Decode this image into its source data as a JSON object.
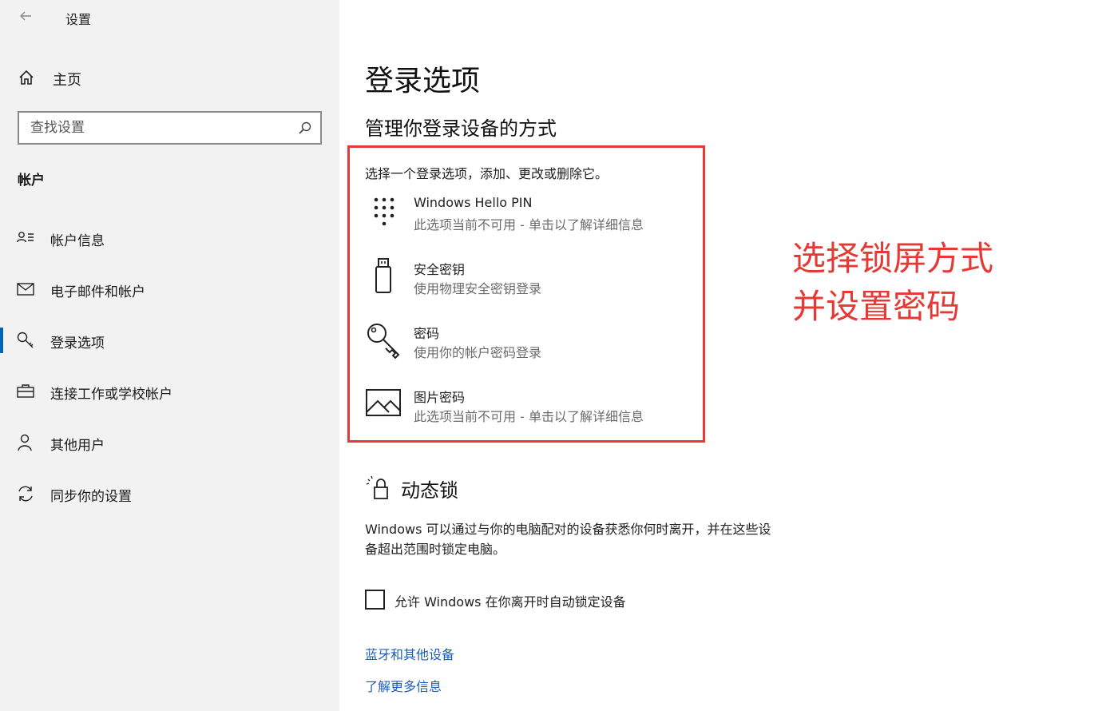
{
  "window": {
    "title": "设置"
  },
  "sidebar": {
    "home_label": "主页",
    "search_placeholder": "查找设置",
    "section_label": "帐户",
    "items": [
      {
        "label": "帐户信息",
        "icon": "account-info-icon"
      },
      {
        "label": "电子邮件和帐户",
        "icon": "mail-icon"
      },
      {
        "label": "登录选项",
        "icon": "key-icon",
        "active": true
      },
      {
        "label": "连接工作或学校帐户",
        "icon": "briefcase-icon"
      },
      {
        "label": "其他用户",
        "icon": "person-icon"
      },
      {
        "label": "同步你的设置",
        "icon": "sync-icon"
      }
    ],
    "accent_color": "#0063b1"
  },
  "main": {
    "title": "登录选项",
    "subtitle": "管理你登录设备的方式",
    "intro": "选择一个登录选项，添加、更改或删除它。",
    "options": [
      {
        "name": "Windows Hello PIN",
        "desc": "此选项当前不可用 - 单击以了解详细信息",
        "icon": "pin-keypad-icon"
      },
      {
        "name": "安全密钥",
        "desc": "使用物理安全密钥登录",
        "icon": "usb-key-icon"
      },
      {
        "name": "密码",
        "desc": "使用你的帐户密码登录",
        "icon": "password-key-icon"
      },
      {
        "name": "图片密码",
        "desc": "此选项当前不可用 - 单击以了解详细信息",
        "icon": "picture-icon"
      }
    ],
    "annotation": {
      "line1": "选择锁屏方式",
      "line2": "并设置密码",
      "color": "#e53935"
    },
    "dynamic_lock": {
      "title": "动态锁",
      "desc_line1": "Windows 可以通过与你的电脑配对的设备获悉你何时离开，并在这些设",
      "desc_line2": "备超出范围时锁定电脑。",
      "checkbox_label": "允许 Windows 在你离开时自动锁定设备",
      "checked": false
    },
    "links": [
      "蓝牙和其他设备",
      "了解更多信息"
    ],
    "link_color": "#1e5bb8"
  }
}
